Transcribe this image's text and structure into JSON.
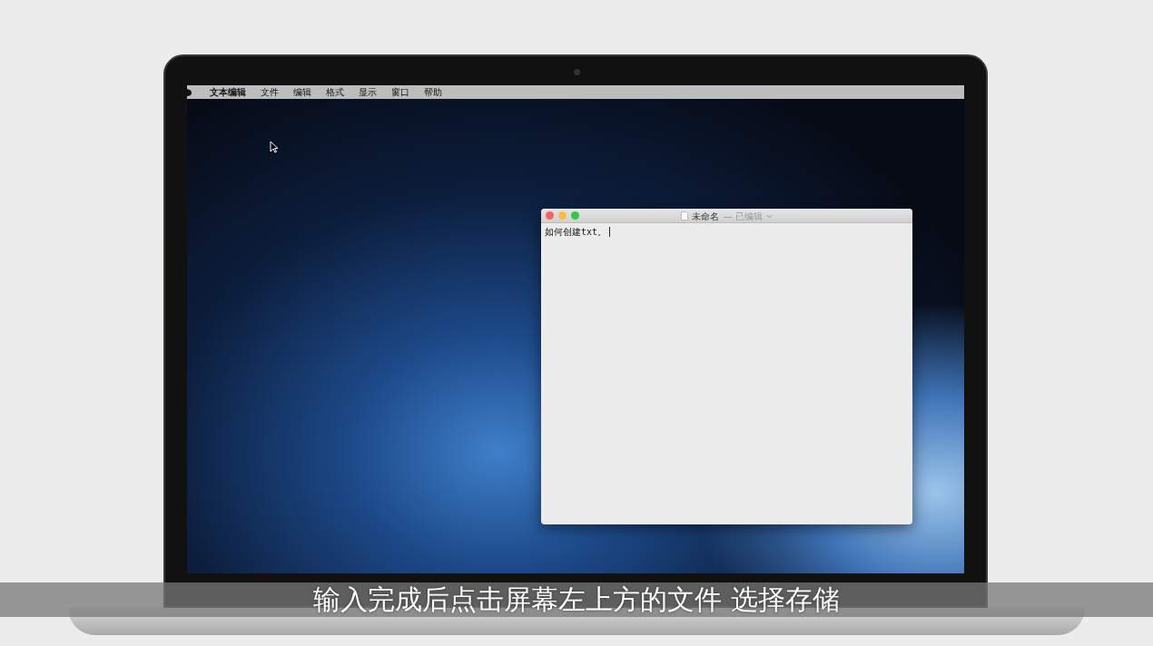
{
  "menu_bar": {
    "app_name": "文本编辑",
    "items": [
      "文件",
      "编辑",
      "格式",
      "显示",
      "窗口",
      "帮助"
    ]
  },
  "window": {
    "title": "未命名",
    "status": "— 已编辑",
    "text": "如何创建txt。"
  },
  "subtitle": "输入完成后点击屏幕左上方的文件 选择存储"
}
